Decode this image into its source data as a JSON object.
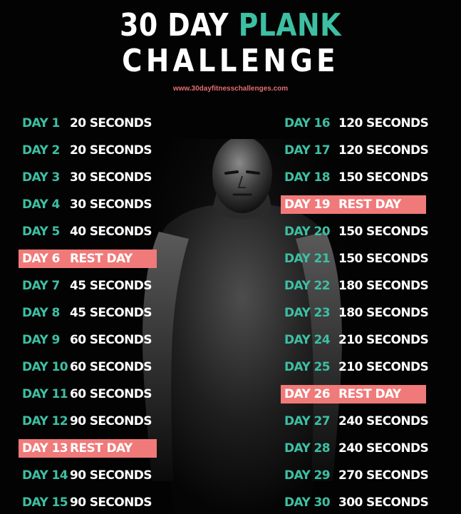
{
  "header": {
    "title_part1": "30 DAY ",
    "title_accent": "PLANK",
    "title_line2": "CHALLENGE",
    "website": "www.30dayfitnesschallenges.com"
  },
  "colors": {
    "background": "#030303",
    "accent_teal": "#3dbfa3",
    "rest_highlight": "#f07a79",
    "text_white": "#ffffff"
  },
  "schedule_left": [
    {
      "day": "DAY 1",
      "duration": "20 SECONDS"
    },
    {
      "day": "DAY 2",
      "duration": "20 SECONDS"
    },
    {
      "day": "DAY 3",
      "duration": "30 SECONDS"
    },
    {
      "day": "DAY 4",
      "duration": "30 SECONDS"
    },
    {
      "day": "DAY 5",
      "duration": "40 SECONDS"
    },
    {
      "day": "DAY 6",
      "duration": "REST DAY"
    },
    {
      "day": "DAY 7",
      "duration": "45 SECONDS"
    },
    {
      "day": "DAY 8",
      "duration": "45 SECONDS"
    },
    {
      "day": "DAY 9",
      "duration": "60 SECONDS"
    },
    {
      "day": "DAY 10",
      "duration": "60 SECONDS"
    },
    {
      "day": "DAY 11",
      "duration": "60 SECONDS"
    },
    {
      "day": "DAY 12",
      "duration": "90 SECONDS"
    },
    {
      "day": "DAY 13",
      "duration": "REST DAY"
    },
    {
      "day": "DAY 14",
      "duration": "90 SECONDS"
    },
    {
      "day": "DAY 15",
      "duration": "90 SECONDS"
    }
  ],
  "schedule_right": [
    {
      "day": "DAY 16",
      "duration": "120 SECONDS"
    },
    {
      "day": "DAY 17",
      "duration": "120 SECONDS"
    },
    {
      "day": "DAY 18",
      "duration": "150 SECONDS"
    },
    {
      "day": "DAY 19",
      "duration": "REST DAY"
    },
    {
      "day": "DAY 20",
      "duration": "150 SECONDS"
    },
    {
      "day": "DAY 21",
      "duration": "150 SECONDS"
    },
    {
      "day": "DAY 22",
      "duration": "180 SECONDS"
    },
    {
      "day": "DAY 23",
      "duration": "180 SECONDS"
    },
    {
      "day": "DAY 24",
      "duration": "210 SECONDS"
    },
    {
      "day": "DAY 25",
      "duration": "210 SECONDS"
    },
    {
      "day": "DAY 26",
      "duration": "REST DAY"
    },
    {
      "day": "DAY 27",
      "duration": "240 SECONDS"
    },
    {
      "day": "DAY 28",
      "duration": "240 SECONDS"
    },
    {
      "day": "DAY 29",
      "duration": "270 SECONDS"
    },
    {
      "day": "DAY 30",
      "duration": "300 SECONDS"
    }
  ]
}
